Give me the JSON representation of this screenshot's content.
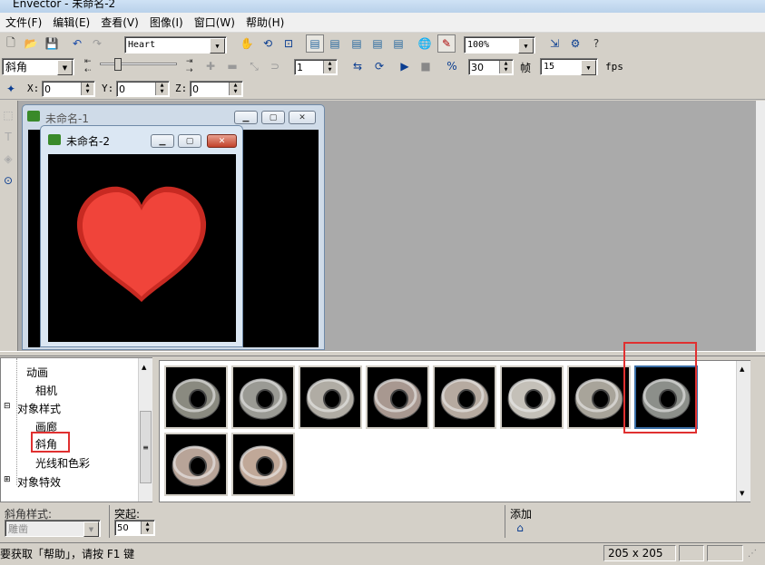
{
  "window": {
    "title": "Envector - 未命名-2"
  },
  "menu": [
    "文件(F)",
    "编辑(E)",
    "查看(V)",
    "图像(I)",
    "窗口(W)",
    "帮助(H)"
  ],
  "toolbar1": {
    "text_combo_value": "Heart",
    "zoom_value": "100%",
    "icons": [
      "new-icon",
      "open-icon",
      "save-icon",
      "undo-icon",
      "redo-icon",
      "hand-icon",
      "rotate-icon",
      "fit-icon",
      "view1-icon",
      "view2-icon",
      "view3-icon",
      "view4-icon",
      "view5-icon",
      "globe-icon",
      "edit-icon",
      "export-icon",
      "settings-icon",
      "help-icon"
    ]
  },
  "toolbar2": {
    "style_combo_value": "斜角",
    "frame_value": "1",
    "speed_value": "30",
    "frame_label": "帧",
    "fps_value": "15",
    "fps_label": "fps",
    "slider_level": 0.2
  },
  "toolbar3": {
    "x_label": "X:",
    "x_value": "0",
    "y_label": "Y:",
    "y_value": "0",
    "z_label": "Z:",
    "z_value": "0"
  },
  "documents": [
    {
      "title": "未命名-1"
    },
    {
      "title": "未命名-2"
    }
  ],
  "tree": {
    "items": [
      {
        "label": "动画",
        "level": 1
      },
      {
        "label": "相机",
        "level": 1
      },
      {
        "label": "对象样式",
        "level": 0,
        "expander": "⊟"
      },
      {
        "label": "画廊",
        "level": 1
      },
      {
        "label": "斜角",
        "level": 1,
        "highlighted": true
      },
      {
        "label": "光线和色彩",
        "level": 1
      },
      {
        "label": "对象特效",
        "level": 0,
        "expander": "⊞"
      }
    ]
  },
  "gallery": {
    "thumb_count": 10,
    "selected_index": 7
  },
  "props": {
    "bevel_style_label": "斜角样式:",
    "bevel_style_value": "雕凿",
    "emboss_label": "突起:",
    "emboss_value": "50",
    "add_label": "添加"
  },
  "status": {
    "help_text": "要获取「帮助」，请按 F1 键",
    "size": "205 x 205"
  },
  "colors": {
    "heart": "#f0443a",
    "selection": "#e03030",
    "workspace": "#aaaaaa"
  }
}
